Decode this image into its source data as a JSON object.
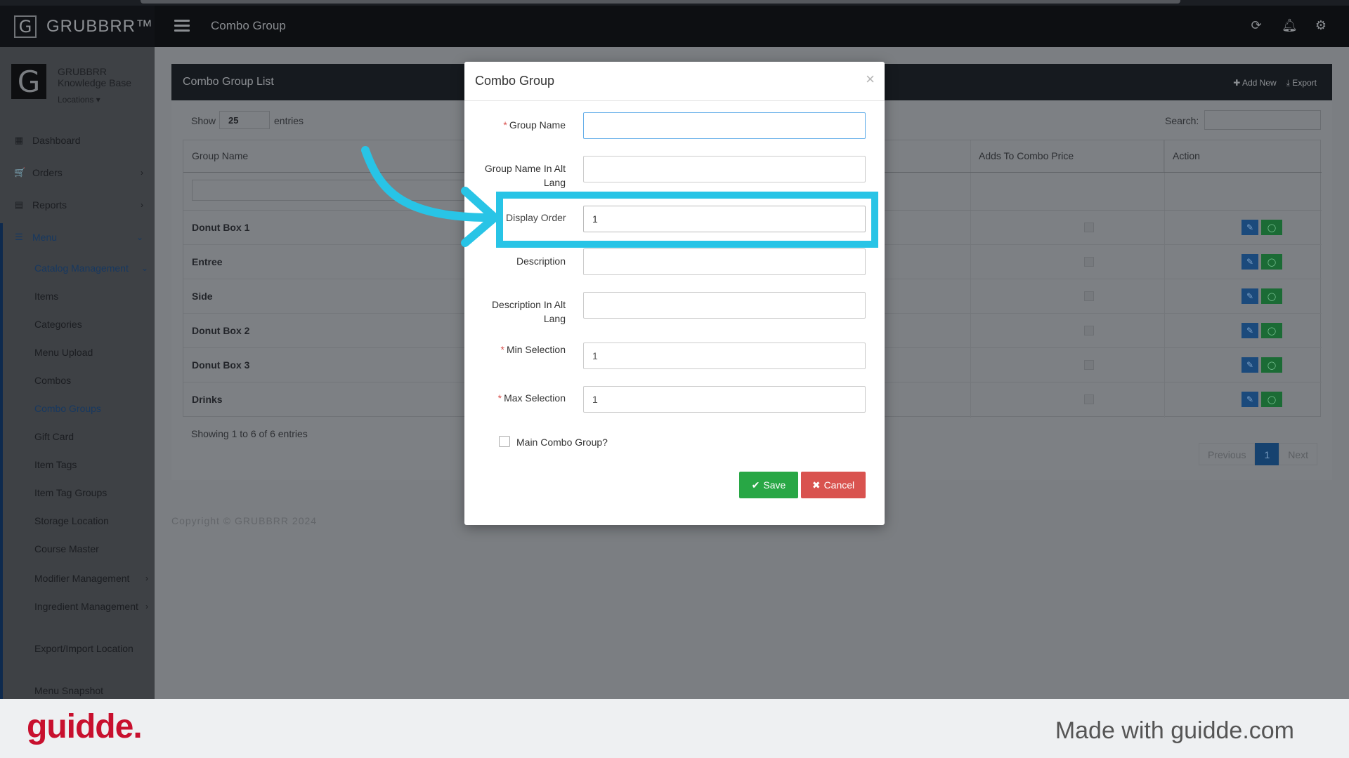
{
  "app": {
    "brand": "GRUBBRR™",
    "brand_letter": "G",
    "page_title": "Combo Group"
  },
  "icons": {
    "refresh": "refresh-icon",
    "bell": "bell-icon",
    "gear": "gear-icon"
  },
  "profile": {
    "letter": "G",
    "name": "GRUBBRR Knowledge Base",
    "locations": "Locations ▾"
  },
  "sidebar": {
    "main": [
      {
        "label": "Dashboard",
        "icon": "▦"
      },
      {
        "label": "Orders",
        "icon": "🛒",
        "chevron": "›"
      },
      {
        "label": "Reports",
        "icon": "▤",
        "chevron": "›"
      },
      {
        "label": "Menu",
        "icon": "☰",
        "chevron": "⌄"
      }
    ],
    "catalog": {
      "label": "Catalog Management",
      "chevron": "⌄"
    },
    "sub": [
      "Items",
      "Categories",
      "Menu Upload",
      "Combos",
      "Combo Groups",
      "Gift Card",
      "Item Tags",
      "Item Tag Groups",
      "Storage Location",
      "Course Master",
      "Modifier Management",
      "Ingredient Management",
      "Export/Import Location",
      "Menu Snapshot"
    ],
    "chevron": "›"
  },
  "panel": {
    "title": "Combo Group List",
    "add_new": "✚ Add New",
    "export": "⤓ Export",
    "show": "Show",
    "page_size": "25",
    "entries": "entries",
    "search": "Search:"
  },
  "table": {
    "headers": [
      "Group Name",
      "Adds To Combo Price",
      "Action"
    ],
    "rows": [
      "Donut Box 1",
      "Entree",
      "Side",
      "Donut Box 2",
      "Donut Box 3",
      "Drinks"
    ],
    "edit_icon": "✎",
    "toggle_icon": "◯"
  },
  "showing": "Showing 1 to 6 of 6 entries",
  "pager": {
    "previous": "Previous",
    "current": "1",
    "next": "Next"
  },
  "copyright": "Copyright © GRUBBRR 2024",
  "modal": {
    "title": "Combo Group",
    "close": "×",
    "fields": {
      "group_name": {
        "label": "Group Name",
        "value": ""
      },
      "group_name_alt": {
        "label": "Group Name In Alt Lang",
        "value": ""
      },
      "display_order": {
        "label": "Display Order",
        "value": "1"
      },
      "description": {
        "label": "Description",
        "value": ""
      },
      "description_alt": {
        "label": "Description In Alt Lang",
        "value": ""
      },
      "min_selection": {
        "label": "Min Selection",
        "value": "1"
      },
      "max_selection": {
        "label": "Max Selection",
        "value": "1"
      }
    },
    "required_mark": "*",
    "main_combo": "Main Combo Group?",
    "save": "Save",
    "save_icon": "✔",
    "cancel": "Cancel",
    "cancel_icon": "✖"
  },
  "footer": {
    "logo": "guidde.",
    "made_with": "Made with guidde.com"
  },
  "colors": {
    "highlight": "#28c4e6",
    "save": "#28a745",
    "cancel": "#d9534f",
    "logo": "#c8102e"
  }
}
